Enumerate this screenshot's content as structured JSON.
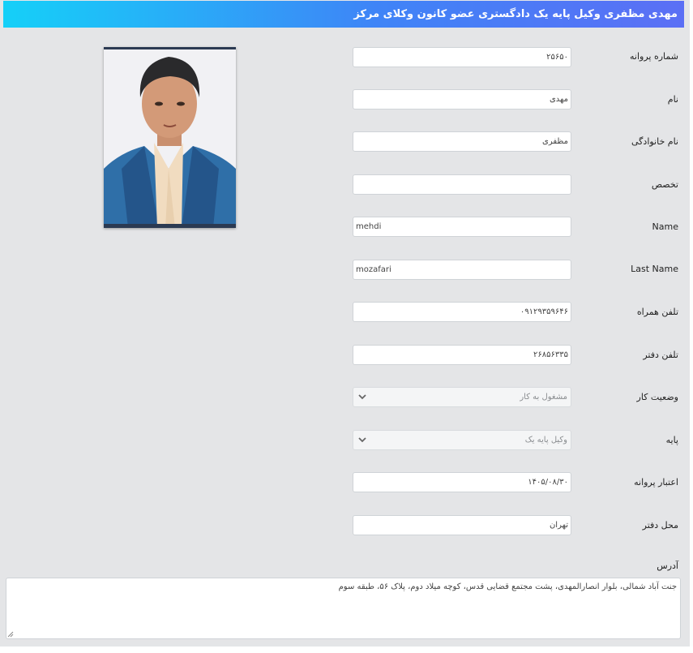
{
  "header": {
    "title": "مهدی مظفری وکیل پایه یک دادگستری عضو کانون وکلای مرکز"
  },
  "form": {
    "license_number": {
      "label": "شماره پروانه",
      "value": "۲۵۶۵۰"
    },
    "first_name": {
      "label": "نام",
      "value": "مهدی"
    },
    "family_name": {
      "label": "نام خانوادگی",
      "value": "مظفری"
    },
    "specialty": {
      "label": "تخصص",
      "value": ""
    },
    "name_en": {
      "label": "Name",
      "value": "mehdi"
    },
    "last_name_en": {
      "label": "Last Name",
      "value": "mozafari"
    },
    "mobile": {
      "label": "تلفن همراه",
      "value": "۰۹۱۲۹۳۵۹۶۴۶"
    },
    "office_phone": {
      "label": "تلفن دفتر",
      "value": "۲۶۸۵۶۳۳۵"
    },
    "work_status": {
      "label": "وضعیت کار",
      "value": "مشغول به کار"
    },
    "grade": {
      "label": "پایه",
      "value": "وکیل پایه یک"
    },
    "license_validity": {
      "label": "اعتبار پروانه",
      "value": "۱۴۰۵/۰۸/۳۰"
    },
    "office_location": {
      "label": "محل دفتر",
      "value": "تهران"
    },
    "address": {
      "label": "آدرس",
      "value": "جنت آباد شمالی، بلوار انصارالمهدی، پشت مجتمع قضایی قدس، کوچه میلاد دوم، پلاک ۵۶، طبقه سوم"
    }
  },
  "photo": {
    "icon": "profile-photo"
  }
}
